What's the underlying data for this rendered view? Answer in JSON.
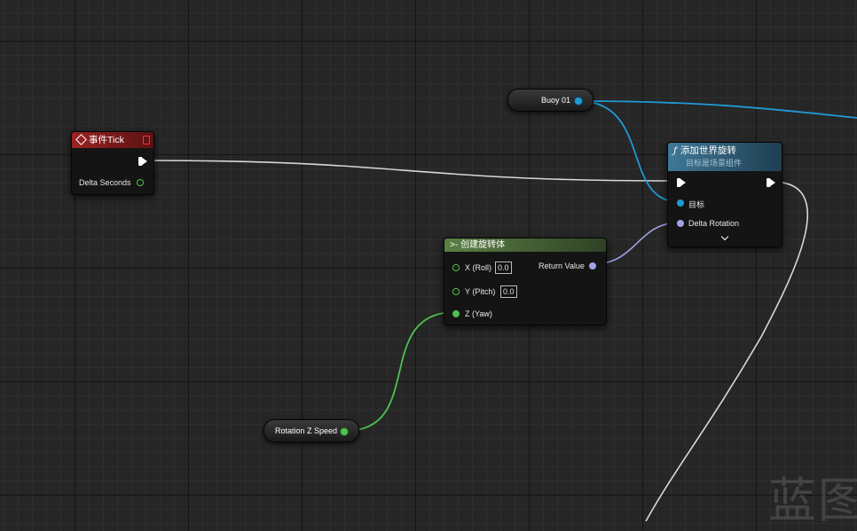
{
  "nodes": {
    "event_tick": {
      "title": "事件Tick",
      "delta_seconds": "Delta Seconds"
    },
    "add_world_rotation": {
      "title": "添加世界旋转",
      "subtitle": "目标是场景组件",
      "target": "目标",
      "delta_rotation": "Delta Rotation"
    },
    "make_rotator": {
      "title": "创建旋转体",
      "x_label": "X (Roll)",
      "x_value": "0.0",
      "y_label": "Y (Pitch)",
      "y_value": "0.0",
      "z_label": "Z (Yaw)",
      "return_value": "Return Value"
    },
    "buoy_var": {
      "label": "Buoy 01"
    },
    "rotation_speed_var": {
      "label": "Rotation Z Speed"
    }
  },
  "watermark": "蓝图",
  "colors": {
    "exec_wire": "#d8d8d8",
    "object_wire": "#1f9ad6",
    "rotator_wire": "#9fa3e6",
    "float_wire": "#4ec24e",
    "event_header": "#8c1c1c",
    "function_header": "#2d5f78",
    "pure_header": "#4e6e3a"
  }
}
